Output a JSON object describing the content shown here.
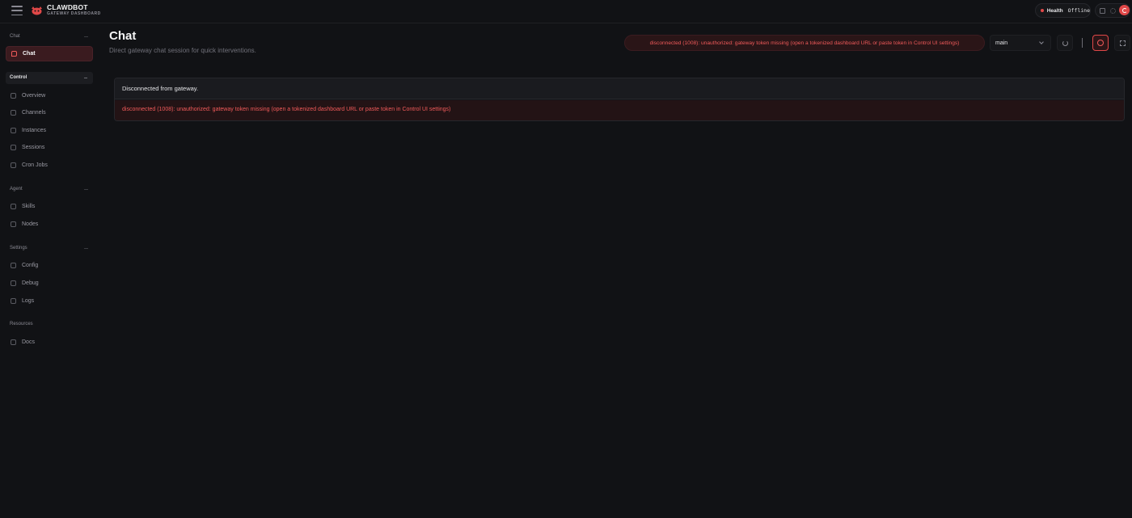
{
  "brand": {
    "title": "CLAWDBOT",
    "subtitle": "GATEWAY DASHBOARD"
  },
  "header": {
    "health_label": "Health",
    "health_value": "Offline",
    "health_status_color": "#e04848"
  },
  "sidebar": {
    "sections": [
      {
        "label": "Chat",
        "items": [
          {
            "label": "Chat",
            "icon": "message-icon",
            "active": true
          }
        ]
      },
      {
        "label": "Control",
        "items": [
          {
            "label": "Overview",
            "icon": "bar-chart-icon"
          },
          {
            "label": "Channels",
            "icon": "link-icon"
          },
          {
            "label": "Instances",
            "icon": "radio-icon"
          },
          {
            "label": "Sessions",
            "icon": "file-icon"
          },
          {
            "label": "Cron Jobs",
            "icon": "clock-icon"
          }
        ]
      },
      {
        "label": "Agent",
        "items": [
          {
            "label": "Skills",
            "icon": "zap-icon"
          },
          {
            "label": "Nodes",
            "icon": "monitor-icon"
          }
        ]
      },
      {
        "label": "Settings",
        "items": [
          {
            "label": "Config",
            "icon": "settings-icon"
          },
          {
            "label": "Debug",
            "icon": "bug-icon"
          },
          {
            "label": "Logs",
            "icon": "scroll-icon"
          }
        ]
      },
      {
        "label": "Resources",
        "items": [
          {
            "label": "Docs",
            "icon": "book-icon"
          }
        ]
      }
    ]
  },
  "main": {
    "title": "Chat",
    "subtitle": "Direct gateway chat session for quick interventions.",
    "error_pill": "disconnected (1008): unauthorized: gateway token missing (open a tokenized dashboard URL or paste token in Control UI settings)",
    "session_select": "main",
    "chat_status": "Disconnected from gateway.",
    "chat_error": "disconnected (1008): unauthorized: gateway token missing (open a tokenized dashboard URL or paste token in Control UI settings)"
  },
  "colors": {
    "accent": "#e04848",
    "background": "#111215",
    "error_text": "#f05a5a"
  }
}
